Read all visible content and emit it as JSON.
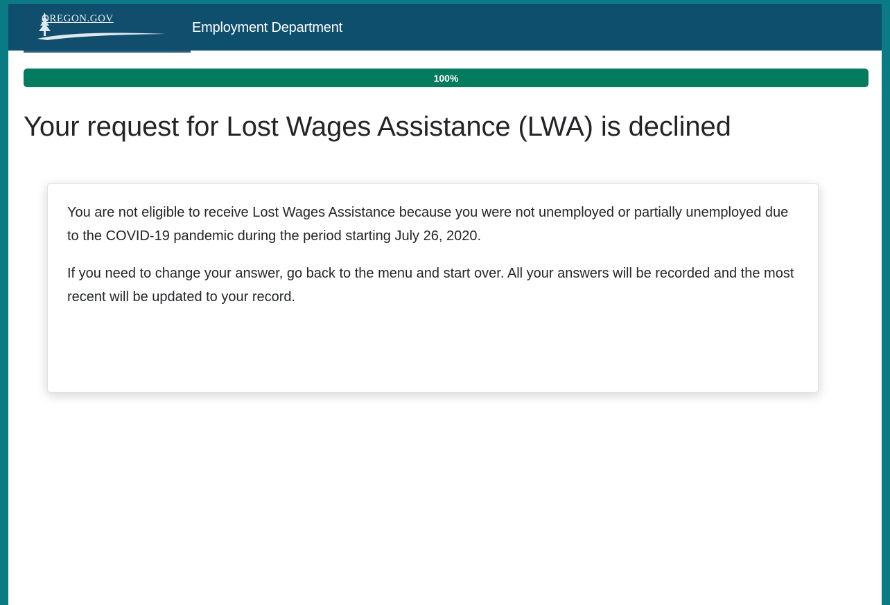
{
  "header": {
    "brand_text": "OREGON.GOV",
    "department": "Employment Department"
  },
  "progress": {
    "label": "100%",
    "value_percent": 100
  },
  "page": {
    "title": "Your request for Lost Wages Assistance (LWA) is declined"
  },
  "card": {
    "paragraph_1": "You are not eligible to receive Lost Wages Assistance because you were not unemployed or partially unemployed due to the COVID-19 pandemic during the period starting July 26, 2020.",
    "paragraph_2": "If you need to change your answer, go back to the menu and start over. All your answers will be recorded and the most recent will be updated to your record."
  },
  "colors": {
    "page_border": "#0a7a85",
    "navbar": "#0e4f6e",
    "progress_fill": "#027b5f",
    "text": "#212529"
  },
  "icons": {
    "brand": "oregon-tree-logo-icon"
  }
}
